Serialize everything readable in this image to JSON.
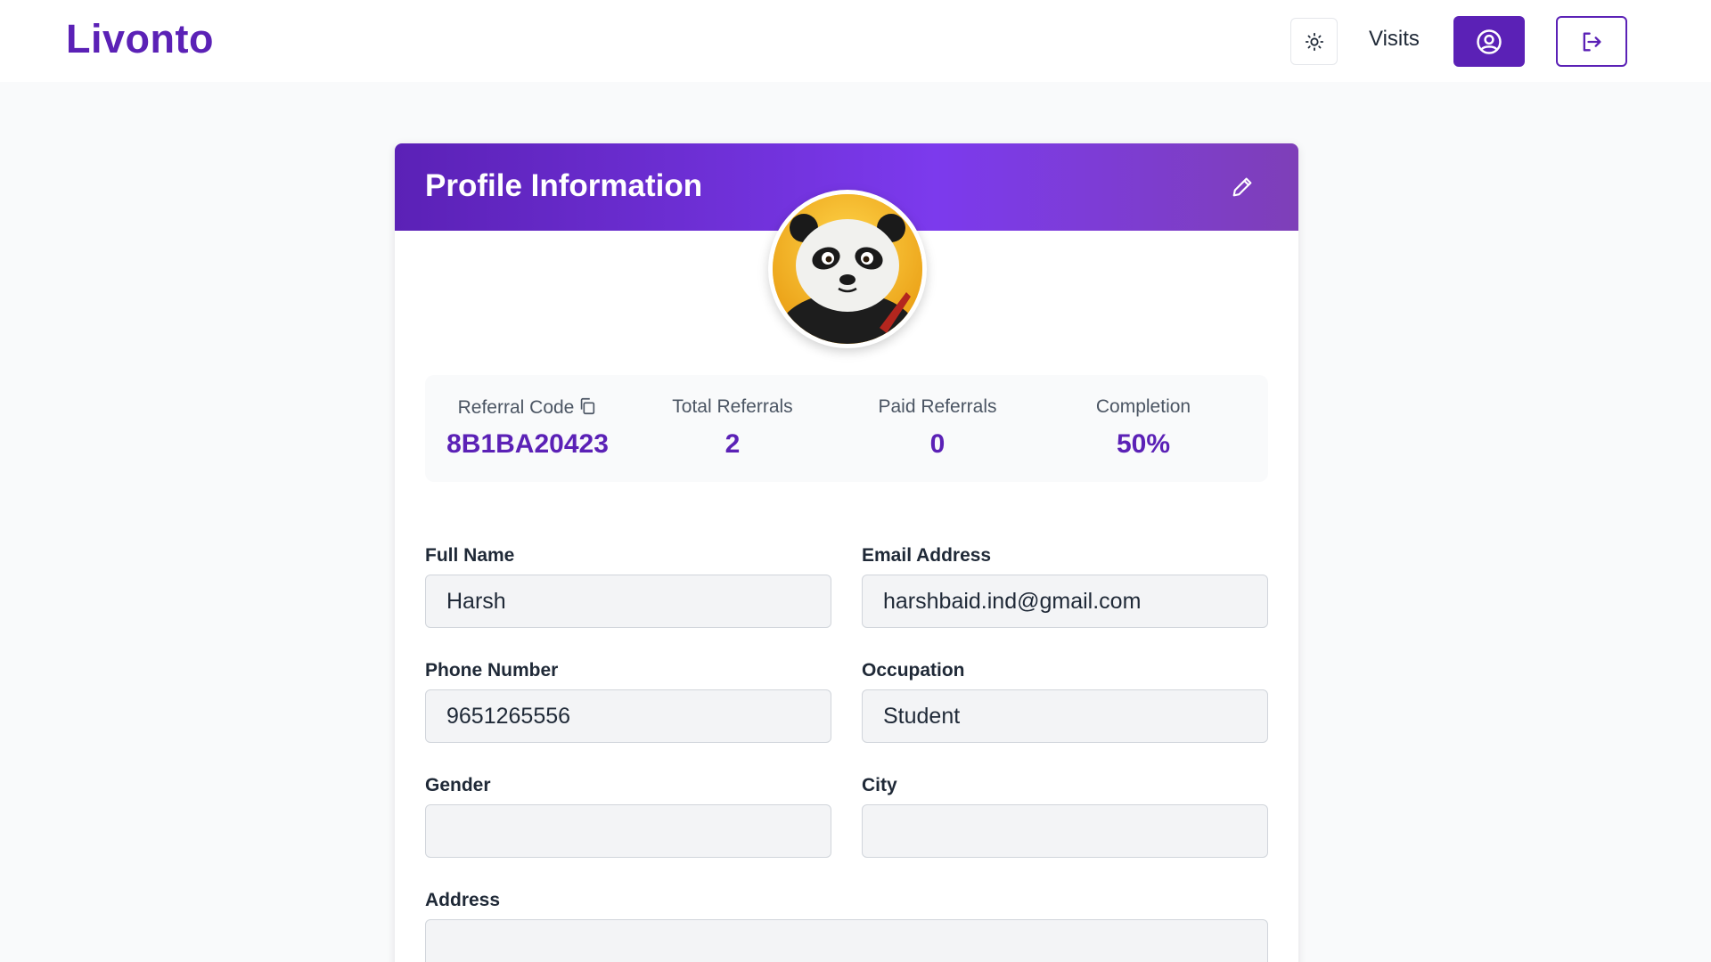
{
  "navbar": {
    "logo": "Livonto",
    "theme_icon": "sun-icon",
    "visits_label": "Visits",
    "profile_icon": "user-circle-icon",
    "logout_icon": "logout-icon"
  },
  "card": {
    "title": "Profile Information",
    "edit_icon": "pencil-icon"
  },
  "stats": {
    "referral_code": {
      "label": "Referral Code",
      "value": "8B1BA20423",
      "icon": "copy-icon"
    },
    "total_referrals": {
      "label": "Total Referrals",
      "value": "2"
    },
    "paid_referrals": {
      "label": "Paid Referrals",
      "value": "0"
    },
    "completion": {
      "label": "Completion",
      "value": "50%"
    }
  },
  "form": {
    "full_name": {
      "label": "Full Name",
      "value": "Harsh"
    },
    "email": {
      "label": "Email Address",
      "value": "harshbaid.ind@gmail.com"
    },
    "phone": {
      "label": "Phone Number",
      "value": "9651265556"
    },
    "occupation": {
      "label": "Occupation",
      "value": "Student"
    },
    "gender": {
      "label": "Gender",
      "value": ""
    },
    "city": {
      "label": "City",
      "value": ""
    },
    "address": {
      "label": "Address",
      "value": ""
    }
  },
  "colors": {
    "brand": "#5b21b6",
    "header_gradient_end": "#7e3fb8",
    "input_bg": "#f3f4f6"
  }
}
